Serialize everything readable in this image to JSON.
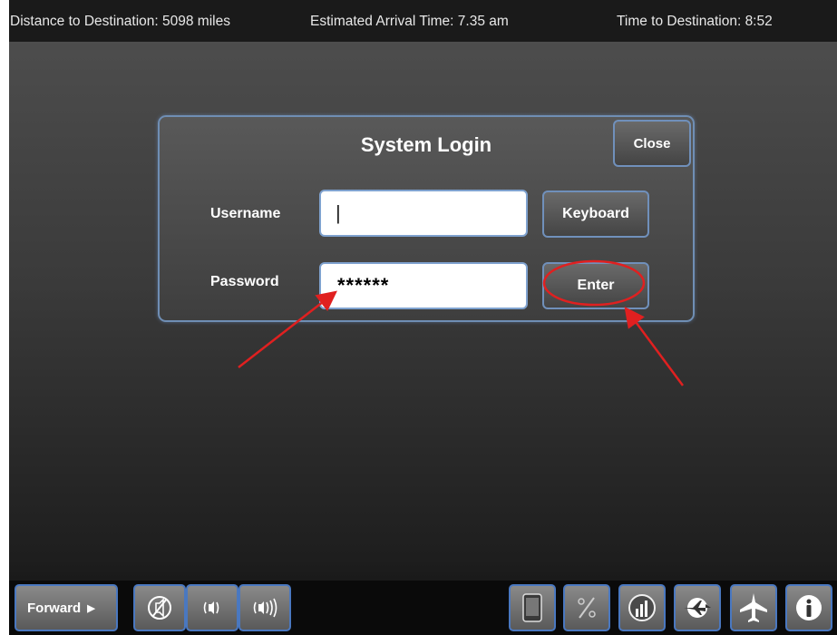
{
  "status_bar": {
    "distance": "Distance to Destination: 5098 miles",
    "arrival": "Estimated Arrival Time: 7.35 am",
    "time_to_dest": "Time to Destination: 8:52"
  },
  "login_dialog": {
    "title": "System Login",
    "close_label": "Close",
    "username_label": "Username",
    "username_value": "|",
    "password_label": "Password",
    "password_value": "******",
    "keyboard_label": "Keyboard",
    "enter_label": "Enter"
  },
  "bottom_bar": {
    "forward_label": "Forward",
    "volume_icons": [
      "mute-icon",
      "volume-low-icon",
      "volume-high-icon"
    ],
    "app_icons": [
      "tablet-icon",
      "percent-icon",
      "chart-icon",
      "globe-plane-icon",
      "airplane-icon",
      "info-icon"
    ]
  },
  "colors": {
    "accent_blue": "#7090bb",
    "annotation_red": "#e02020"
  }
}
